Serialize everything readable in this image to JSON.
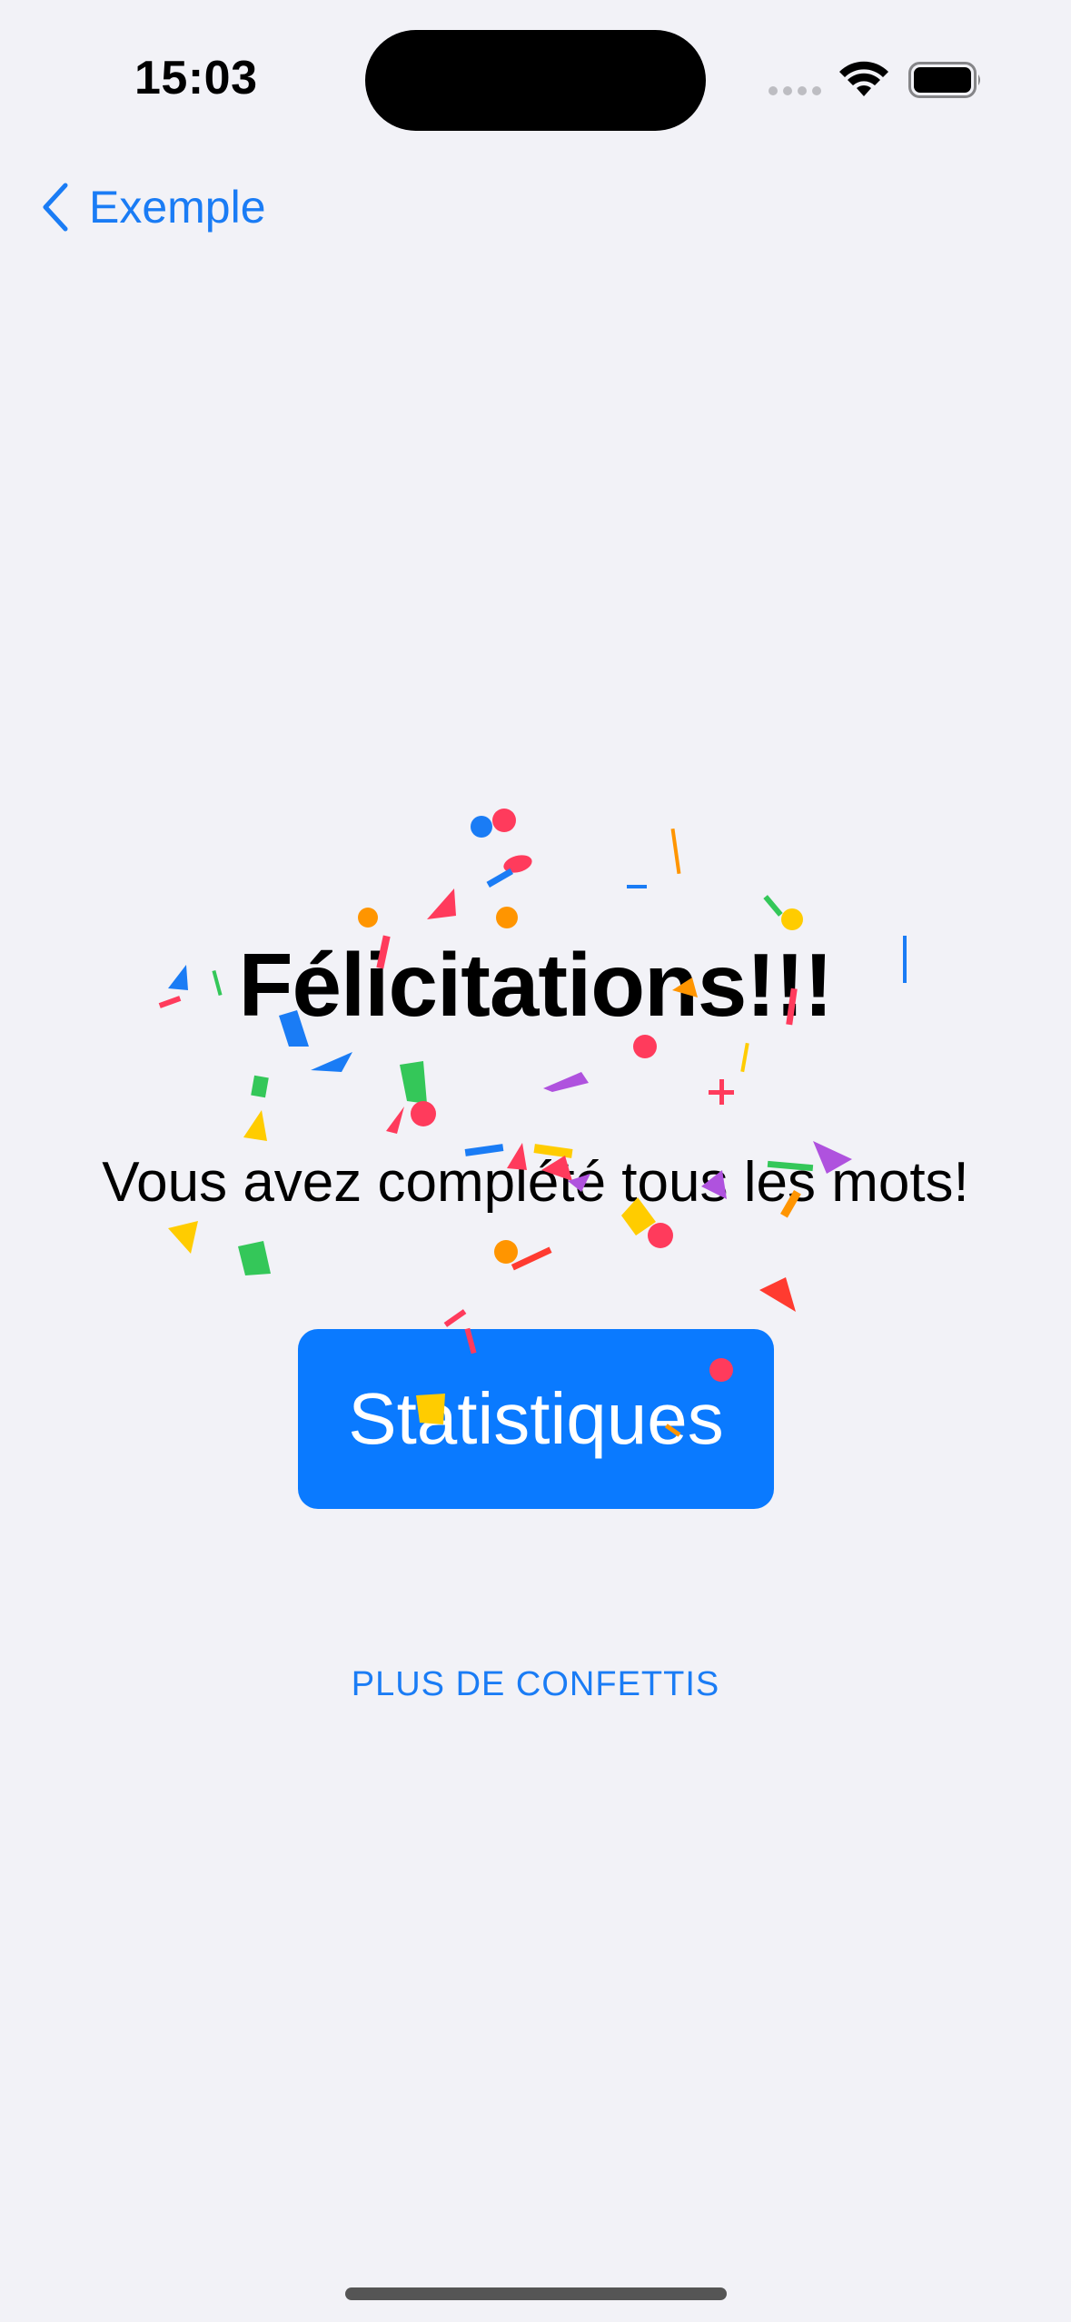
{
  "status_bar": {
    "time": "15:03"
  },
  "navigation": {
    "back_label": "Exemple"
  },
  "content": {
    "title": "Félicitations!!!",
    "subtitle": "Vous avez complété tous les mots!",
    "stats_button_label": "Statistiques",
    "more_confetti_label": "PLUS DE CONFETTIS"
  },
  "colors": {
    "accent": "#0A7AFF",
    "background": "#F2F2F7",
    "confetti": [
      "#FF3B5C",
      "#1A7CF5",
      "#FFCC00",
      "#FF9500",
      "#34C759",
      "#AF52DE",
      "#FF3B30"
    ]
  }
}
